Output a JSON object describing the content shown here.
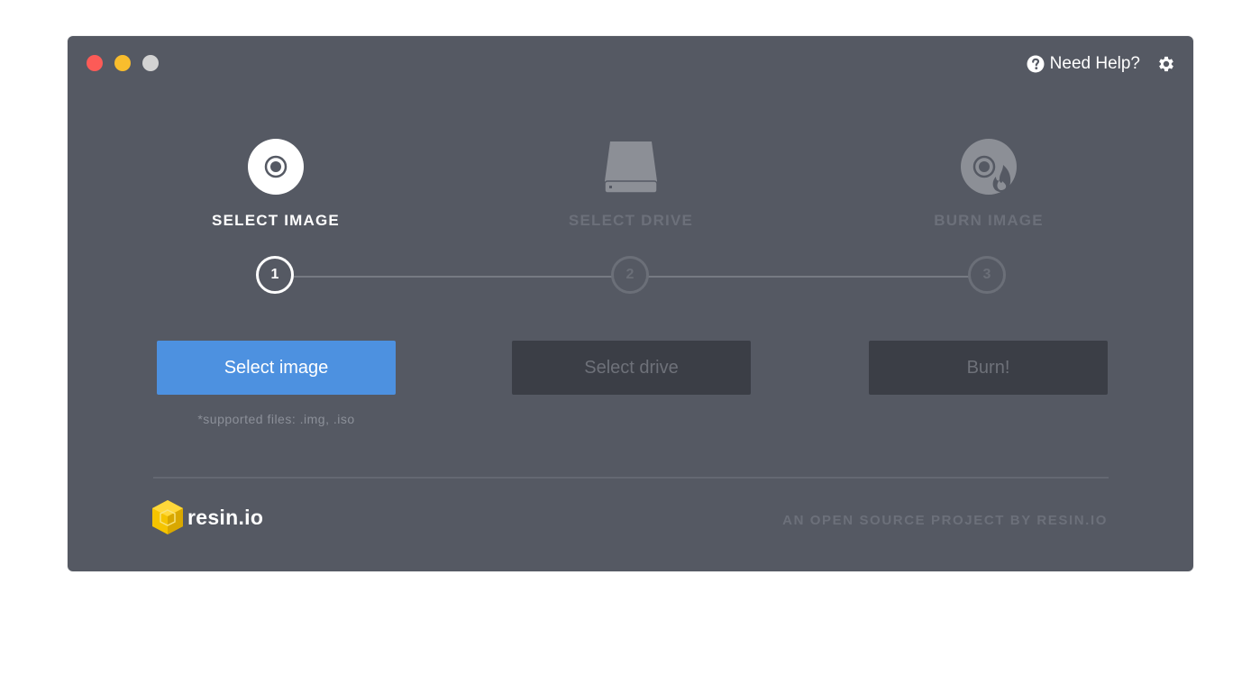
{
  "window": {
    "controls": [
      "close",
      "minimize",
      "maximize"
    ]
  },
  "header": {
    "help_label": "Need Help?",
    "help_icon": "question-circle-icon",
    "settings_icon": "gear-icon"
  },
  "steps": [
    {
      "title": "SELECT IMAGE",
      "icon": "disc-icon",
      "number": "1",
      "active": true
    },
    {
      "title": "SELECT DRIVE",
      "icon": "drive-icon",
      "number": "2",
      "active": false
    },
    {
      "title": "BURN IMAGE",
      "icon": "burn-disc-icon",
      "number": "3",
      "active": false
    }
  ],
  "buttons": {
    "select_image": "Select image",
    "select_drive": "Select drive",
    "burn": "Burn!"
  },
  "supported_files": "*supported files: .img, .iso",
  "footer": {
    "brand": "resin.io",
    "credit": "AN OPEN SOURCE PROJECT BY RESIN.IO"
  },
  "colors": {
    "window_bg": "#555963",
    "primary": "#4d91e0",
    "disabled_button": "#3b3e46",
    "logo_yellow": "#f5c400"
  }
}
